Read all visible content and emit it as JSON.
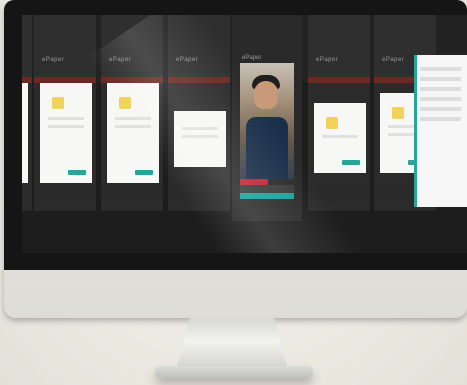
{
  "tiles": [
    {
      "title": "ePaper"
    },
    {
      "title": "ePaper"
    },
    {
      "title": "ePaper"
    },
    {
      "title": "ePaper"
    },
    {
      "title": "ePaper"
    },
    {
      "title": "ePaper"
    }
  ],
  "featured": {
    "title": "ePaper"
  },
  "colors": {
    "accent": "#16a29c",
    "red": "#c1272d",
    "bezel": "#151515"
  }
}
